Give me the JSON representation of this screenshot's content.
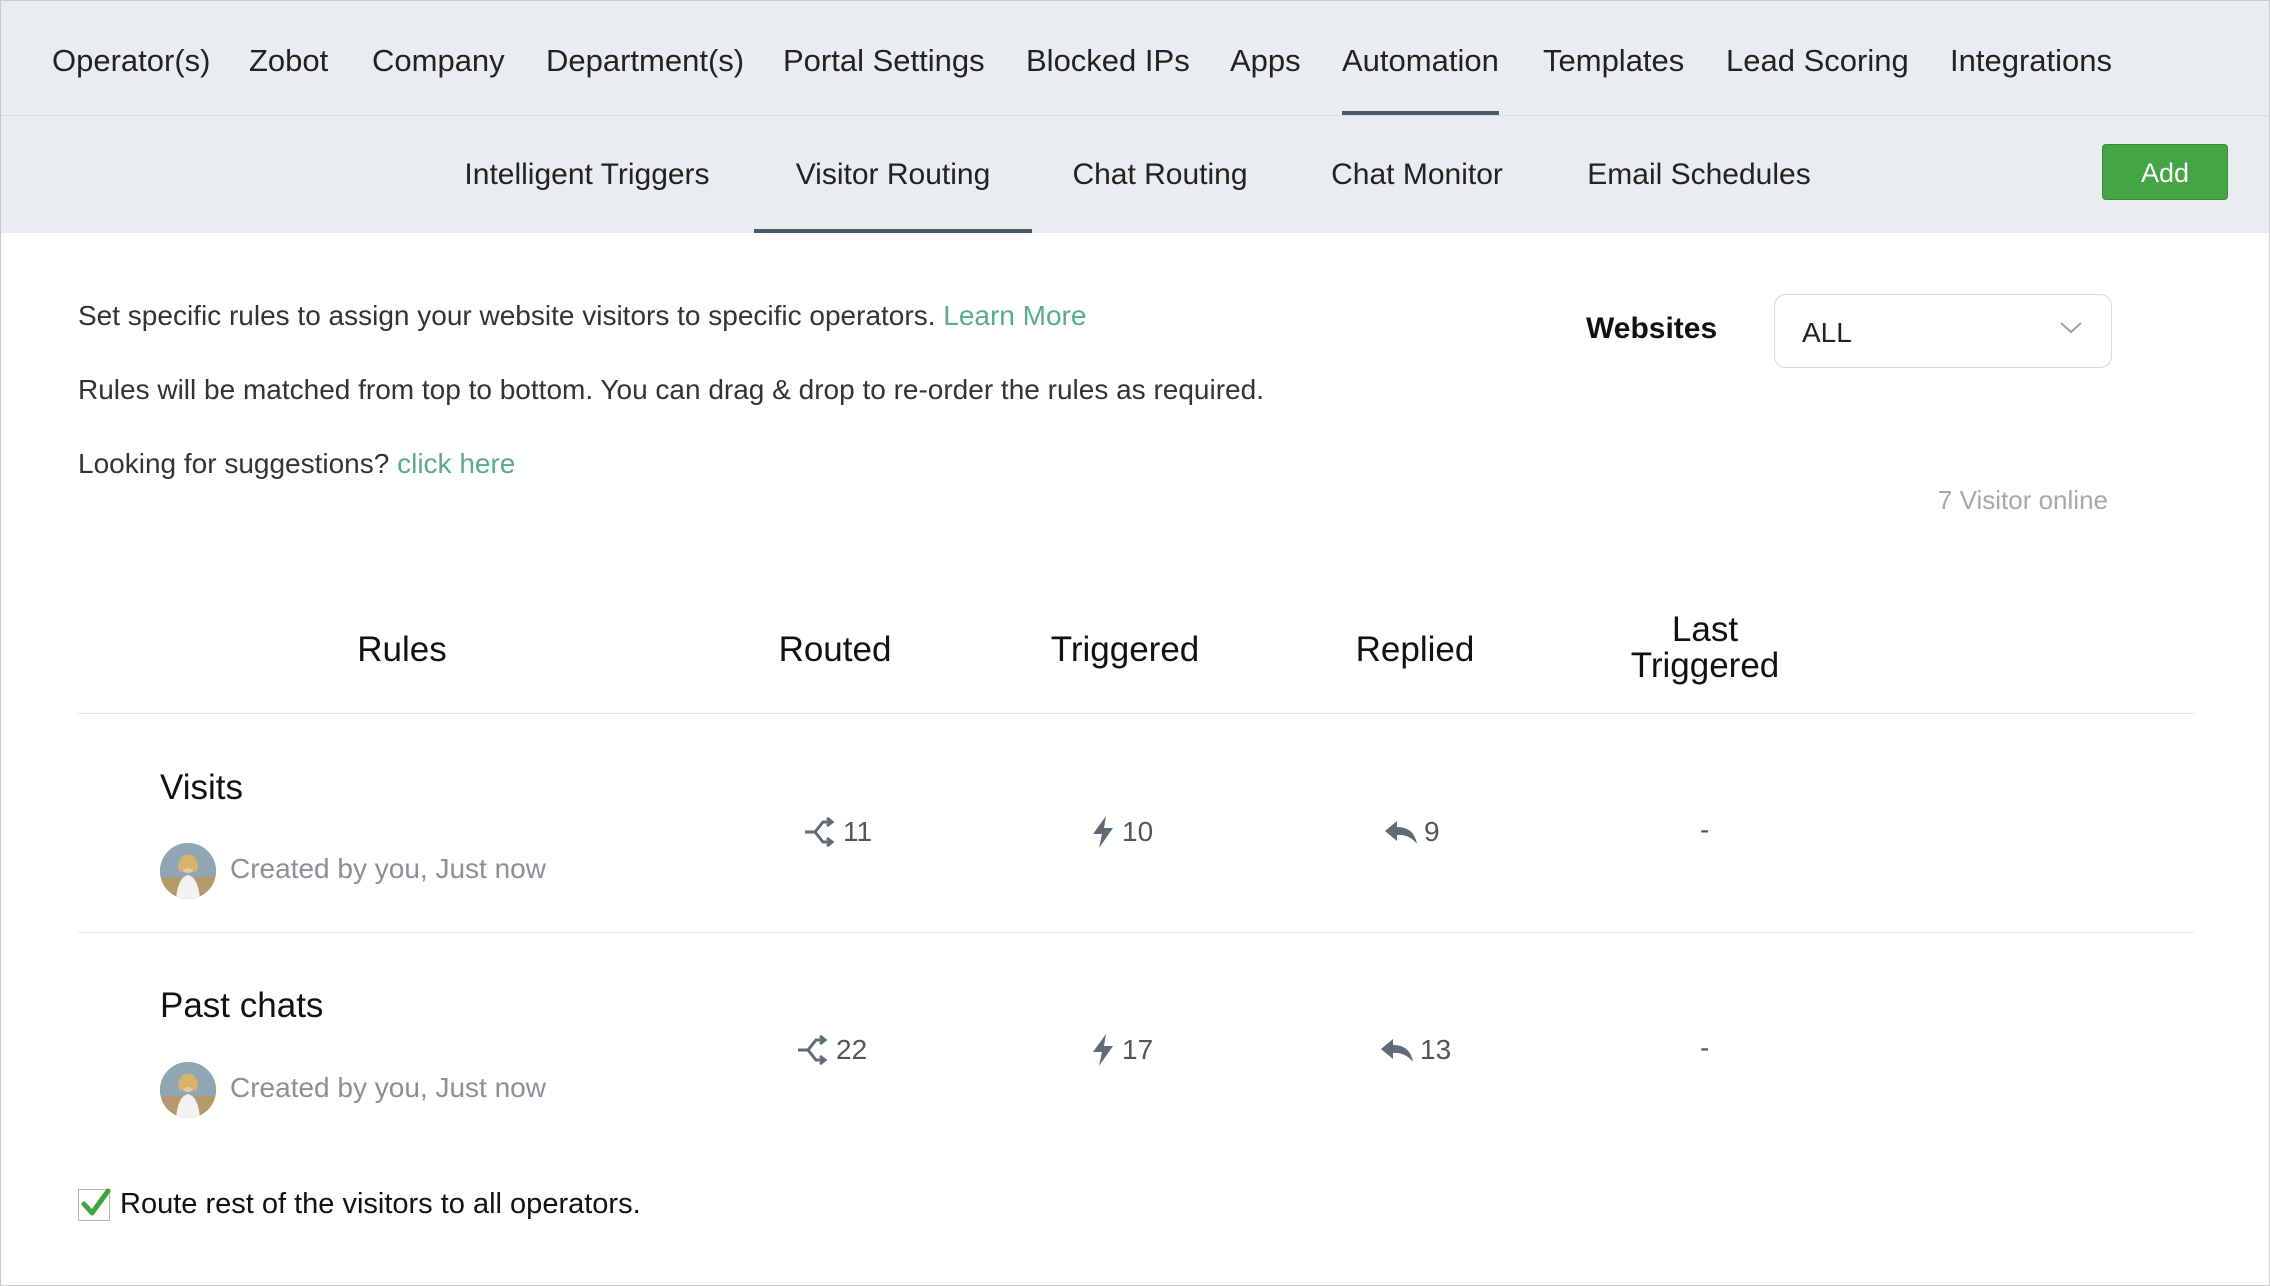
{
  "topnav": {
    "items": [
      {
        "label": "Operator(s)",
        "active": false
      },
      {
        "label": "Zobot",
        "active": false
      },
      {
        "label": "Company",
        "active": false
      },
      {
        "label": "Department(s)",
        "active": false
      },
      {
        "label": "Portal Settings",
        "active": false
      },
      {
        "label": "Blocked IPs",
        "active": false
      },
      {
        "label": "Apps",
        "active": false
      },
      {
        "label": "Automation",
        "active": true
      },
      {
        "label": "Templates",
        "active": false
      },
      {
        "label": "Lead Scoring",
        "active": false
      },
      {
        "label": "Integrations",
        "active": false
      }
    ]
  },
  "subnav": {
    "tabs": [
      {
        "label": "Intelligent Triggers",
        "active": false
      },
      {
        "label": "Visitor Routing",
        "active": true
      },
      {
        "label": "Chat Routing",
        "active": false
      },
      {
        "label": "Chat Monitor",
        "active": false
      },
      {
        "label": "Email Schedules",
        "active": false
      }
    ],
    "add_label": "Add"
  },
  "info": {
    "line1": "Set specific rules to assign your website visitors to specific operators.",
    "learn_more": "Learn More",
    "line2": "Rules will be matched from top to bottom. You can drag & drop to re-order the rules as required.",
    "line3": "Looking for suggestions?",
    "click_here": "click here"
  },
  "websites": {
    "label": "Websites",
    "selected": "ALL"
  },
  "visitors_online": "7 Visitor online",
  "table": {
    "headers": {
      "rules": "Rules",
      "routed": "Routed",
      "triggered": "Triggered",
      "replied": "Replied",
      "last_triggered_1": "Last",
      "last_triggered_2": "Triggered"
    },
    "rows": [
      {
        "name": "Visits",
        "created": "Created by you, Just now",
        "routed": "11",
        "triggered": "10",
        "replied": "9",
        "last": "-"
      },
      {
        "name": "Past chats",
        "created": "Created by you, Just now",
        "routed": "22",
        "triggered": "17",
        "replied": "13",
        "last": "-"
      }
    ]
  },
  "route_rest": {
    "label": "Route rest of the visitors to all operators.",
    "checked": true
  },
  "colors": {
    "accent": "#43a543",
    "link": "#5aab8c",
    "nav_bg": "#eaedf0",
    "active_underline": "#4a5a6a"
  }
}
